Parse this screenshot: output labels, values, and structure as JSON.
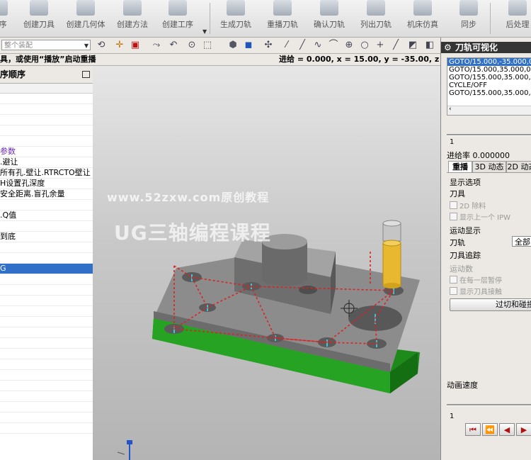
{
  "ribbon": {
    "items": [
      {
        "label": "序"
      },
      {
        "label": "创建刀具"
      },
      {
        "label": "创建几何体"
      },
      {
        "label": "创建方法"
      },
      {
        "label": "创建工序"
      },
      {
        "label": "生成刀轨"
      },
      {
        "label": "重播刀轨"
      },
      {
        "label": "确认刀轨"
      },
      {
        "label": "列出刀轨"
      },
      {
        "label": "机床仿真"
      },
      {
        "label": "同步"
      },
      {
        "label": "后处理"
      }
    ]
  },
  "toolbar": {
    "filter_placeholder": "整个装配"
  },
  "statusbar": {
    "prompt": "具，或使用“播放”启动重播",
    "coords": "进给 = 0.000, x = 15.00, y = -35.00, z = 3.00"
  },
  "nav": {
    "title": "序顺序",
    "rows": [
      {
        "text": ""
      },
      {
        "text": ""
      },
      {
        "text": ""
      },
      {
        "text": ""
      },
      {
        "text": ""
      },
      {
        "text": "参数"
      },
      {
        "text": ".避让"
      },
      {
        "text": "所有孔.壁让.RTRCTO壁让"
      },
      {
        "text": "H设置孔深度"
      },
      {
        "text": "安全距离.盲孔余量"
      },
      {
        "text": ""
      },
      {
        "text": ".Q值"
      },
      {
        "text": ""
      },
      {
        "text": "到底"
      },
      {
        "text": ""
      },
      {
        "text": ""
      },
      {
        "text": "G"
      },
      {
        "text": ""
      },
      {
        "text": ""
      },
      {
        "text": ""
      },
      {
        "text": ""
      },
      {
        "text": ""
      },
      {
        "text": ""
      },
      {
        "text": ""
      },
      {
        "text": ""
      },
      {
        "text": ""
      },
      {
        "text": ""
      },
      {
        "text": ""
      },
      {
        "text": ""
      },
      {
        "text": ""
      },
      {
        "text": ""
      },
      {
        "text": ""
      }
    ]
  },
  "viewport": {
    "watermark_url": "www.52zxw.com原创教程",
    "watermark_title": "UG三轴编程课程"
  },
  "rpanel": {
    "title": "刀轨可视化",
    "goto_lines": [
      "GOTO/15.000,-35.000,0.000",
      "GOTO/15.000,35.000,0.000",
      "GOTO/155.000,35.000,0.000",
      "CYCLE/OFF",
      "GOTO/155.000,35.000,50.000"
    ],
    "slider_value": "1",
    "feed_rate": "进给率 0.000000",
    "tabs": [
      "重播",
      "3D 动态",
      "2D 动态"
    ],
    "display_options": "显示选项",
    "tool_label": "刀具",
    "opt_2d_remove": "2D 除料",
    "opt_prev_ipw": "显示上一个 IPW",
    "motion_display": "运动显示",
    "toolpath_label": "刀轨",
    "toolpath_value": "全部",
    "tool_trace": "刀具追踪",
    "motion_count": "运动数",
    "opt_pause_each": "在每一层暂停",
    "opt_show_contact": "显示刀具接触",
    "gouge_button": "过切和碰撞设置",
    "anim_speed": "动画速度",
    "anim_value": "1",
    "playback": [
      "⏮",
      "⏪",
      "◀",
      "▶"
    ]
  },
  "colors": {
    "selection": "#3170c8",
    "base_green": "#1f8a1c",
    "part_gray": "#8c8c8c",
    "tool_yellow": "#e8b930",
    "toolpath_red": "#e02020"
  }
}
